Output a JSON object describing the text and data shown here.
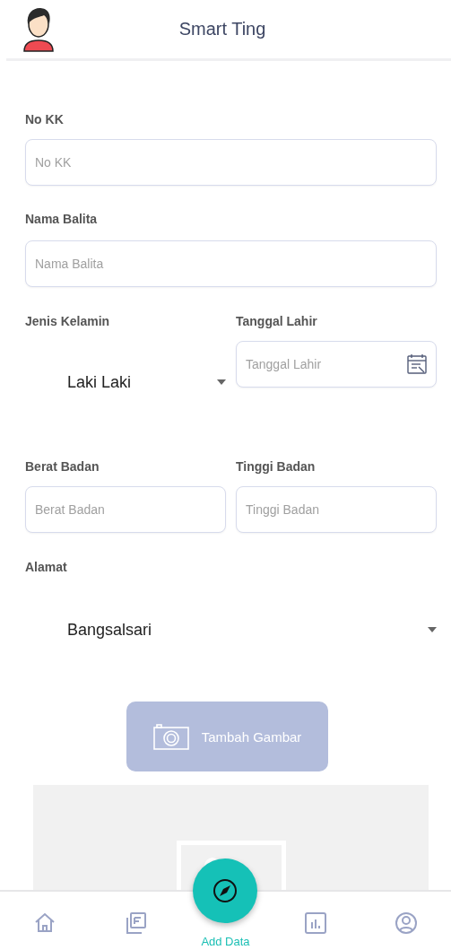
{
  "header": {
    "title": "Smart Ting"
  },
  "no_kk": {
    "label": "No KK",
    "placeholder": "No KK"
  },
  "nama_balita": {
    "label": "Nama Balita",
    "placeholder": "Nama Balita"
  },
  "jenis_kelamin": {
    "label": "Jenis Kelamin",
    "value": "Laki Laki"
  },
  "tanggal_lahir": {
    "label": "Tanggal Lahir",
    "placeholder": "Tanggal Lahir"
  },
  "berat_badan": {
    "label": "Berat Badan",
    "placeholder": "Berat Badan"
  },
  "tinggi_badan": {
    "label": "Tinggi Badan",
    "placeholder": "Tinggi Badan"
  },
  "alamat": {
    "label": "Alamat",
    "value": "Bangsalsari"
  },
  "add_image_button": {
    "label": "Tambah Gambar",
    "disabled": true
  },
  "bottom_nav": {
    "items": [
      {
        "kind": "home",
        "selected": false
      },
      {
        "kind": "list",
        "selected": false
      },
      {
        "kind": "add",
        "label": "Add Data",
        "selected": true
      },
      {
        "kind": "chart",
        "selected": false
      },
      {
        "kind": "profile",
        "selected": false
      }
    ]
  }
}
